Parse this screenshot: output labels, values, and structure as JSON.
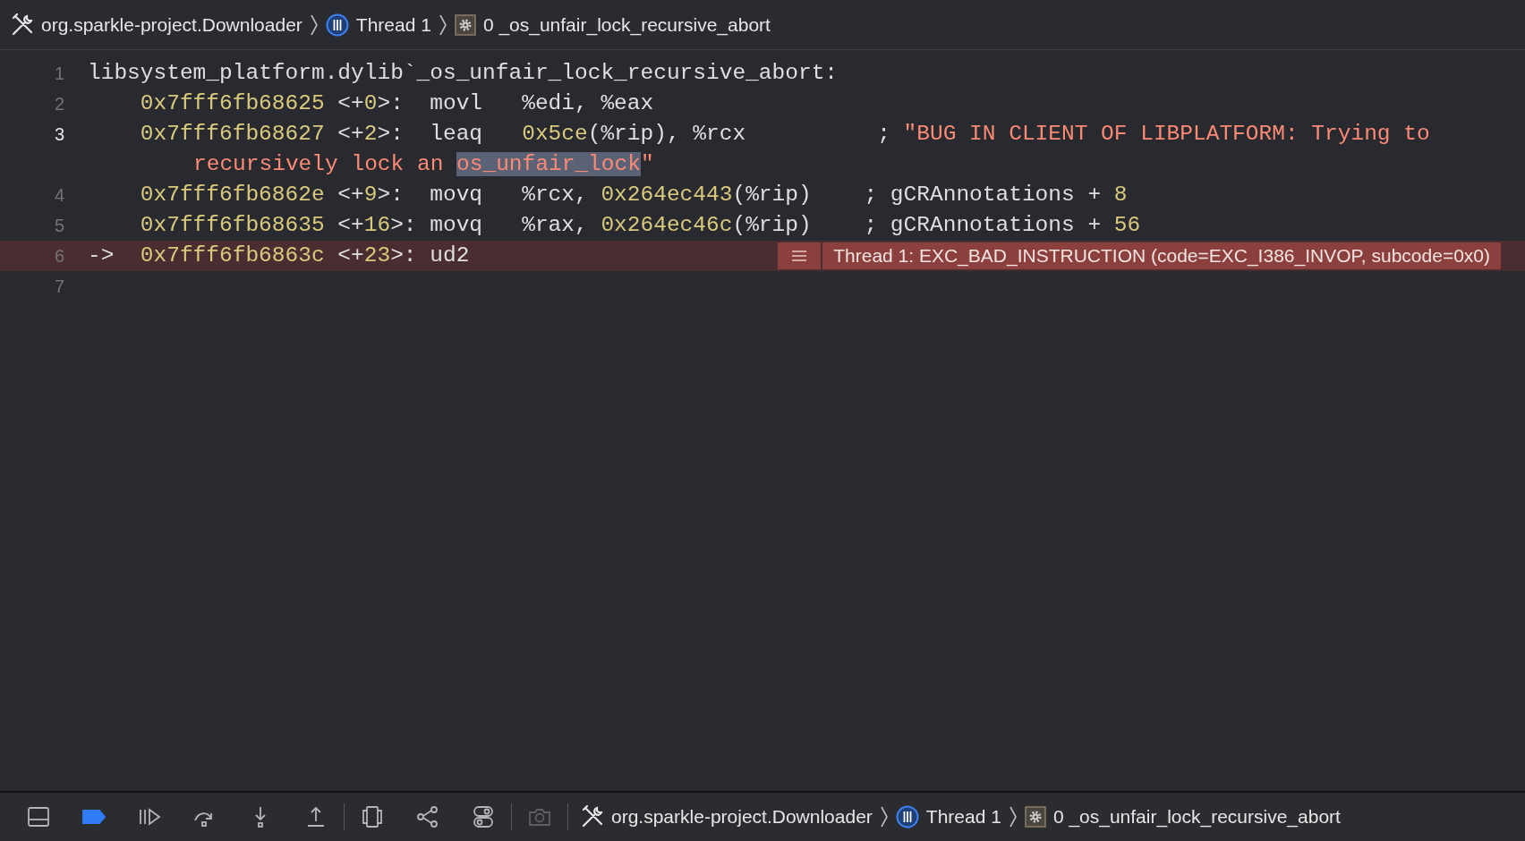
{
  "jump_bar": [
    {
      "kind": "tools",
      "label": "org.sparkle-project.Downloader"
    },
    {
      "kind": "thread",
      "label": "Thread 1"
    },
    {
      "kind": "gear",
      "label": "0 _os_unfair_lock_recursive_abort"
    }
  ],
  "code_lines": [
    {
      "number": "1",
      "selected": false,
      "kind": "label",
      "segments": [
        {
          "kind": "plain",
          "text": "libsystem_platform.dylib`_os_unfair_lock_recursive_abort:"
        }
      ]
    },
    {
      "number": "2",
      "selected": false,
      "kind": "instruction",
      "segments": [
        {
          "kind": "number",
          "text": "0x7fff6fb68625"
        },
        {
          "kind": "plain",
          "text": " <+"
        },
        {
          "kind": "number",
          "text": "0"
        },
        {
          "kind": "plain",
          "text": ">:  movl   %edi, %eax"
        }
      ]
    },
    {
      "number": "3",
      "selected": true,
      "kind": "instruction",
      "segments": [
        {
          "kind": "number",
          "text": "0x7fff6fb68627"
        },
        {
          "kind": "plain",
          "text": " <+"
        },
        {
          "kind": "number",
          "text": "2"
        },
        {
          "kind": "plain",
          "text": ">:  leaq   "
        },
        {
          "kind": "number",
          "text": "0x5ce"
        },
        {
          "kind": "plain",
          "text": "(%rip), %rcx          ; "
        },
        {
          "kind": "string",
          "text": "\"BUG IN CLIENT OF LIBPLATFORM: Trying to"
        }
      ],
      "wrap": [
        {
          "kind": "string",
          "text": "recursively lock an "
        },
        {
          "kind": "highlight",
          "text": "os_unfair_lock"
        },
        {
          "kind": "string",
          "text": "\""
        }
      ]
    },
    {
      "number": "4",
      "selected": false,
      "kind": "instruction",
      "segments": [
        {
          "kind": "number",
          "text": "0x7fff6fb6862e"
        },
        {
          "kind": "plain",
          "text": " <+"
        },
        {
          "kind": "number",
          "text": "9"
        },
        {
          "kind": "plain",
          "text": ">:  movq   %rcx, "
        },
        {
          "kind": "number",
          "text": "0x264ec443"
        },
        {
          "kind": "plain",
          "text": "(%rip)    ; gCRAnnotations + "
        },
        {
          "kind": "number",
          "text": "8"
        }
      ]
    },
    {
      "number": "5",
      "selected": false,
      "kind": "instruction",
      "segments": [
        {
          "kind": "number",
          "text": "0x7fff6fb68635"
        },
        {
          "kind": "plain",
          "text": " <+"
        },
        {
          "kind": "number",
          "text": "16"
        },
        {
          "kind": "plain",
          "text": ">: movq   %rax, "
        },
        {
          "kind": "number",
          "text": "0x264ec46c"
        },
        {
          "kind": "plain",
          "text": "(%rip)    ; gCRAnnotations + "
        },
        {
          "kind": "number",
          "text": "56"
        }
      ]
    },
    {
      "number": "6",
      "selected": false,
      "current": true,
      "kind": "instruction",
      "arrow": "->",
      "segments": [
        {
          "kind": "number",
          "text": "0x7fff6fb6863c"
        },
        {
          "kind": "plain",
          "text": " <+"
        },
        {
          "kind": "number",
          "text": "23"
        },
        {
          "kind": "plain",
          "text": ">: ud2"
        }
      ],
      "annotation": "Thread 1: EXC_BAD_INSTRUCTION (code=EXC_I386_INVOP, subcode=0x0)"
    },
    {
      "number": "7",
      "selected": false
    }
  ],
  "debug_bar": {
    "tools": [
      {
        "kind": "panel"
      },
      {
        "kind": "breakpoints",
        "on": true
      },
      {
        "kind": "continue"
      },
      {
        "kind": "step-over"
      },
      {
        "kind": "step-into"
      },
      {
        "kind": "step-out"
      },
      {
        "kind": "separator"
      },
      {
        "kind": "view-debugger"
      },
      {
        "kind": "memory-graph"
      },
      {
        "kind": "environment"
      },
      {
        "kind": "separator"
      },
      {
        "kind": "camera",
        "disabled": true
      },
      {
        "kind": "separator"
      }
    ],
    "jump_bar": [
      {
        "kind": "tools",
        "label": "org.sparkle-project.Downloader"
      },
      {
        "kind": "thread",
        "label": "Thread 1"
      },
      {
        "kind": "gear",
        "label": "0 _os_unfair_lock_recursive_abort"
      }
    ]
  }
}
